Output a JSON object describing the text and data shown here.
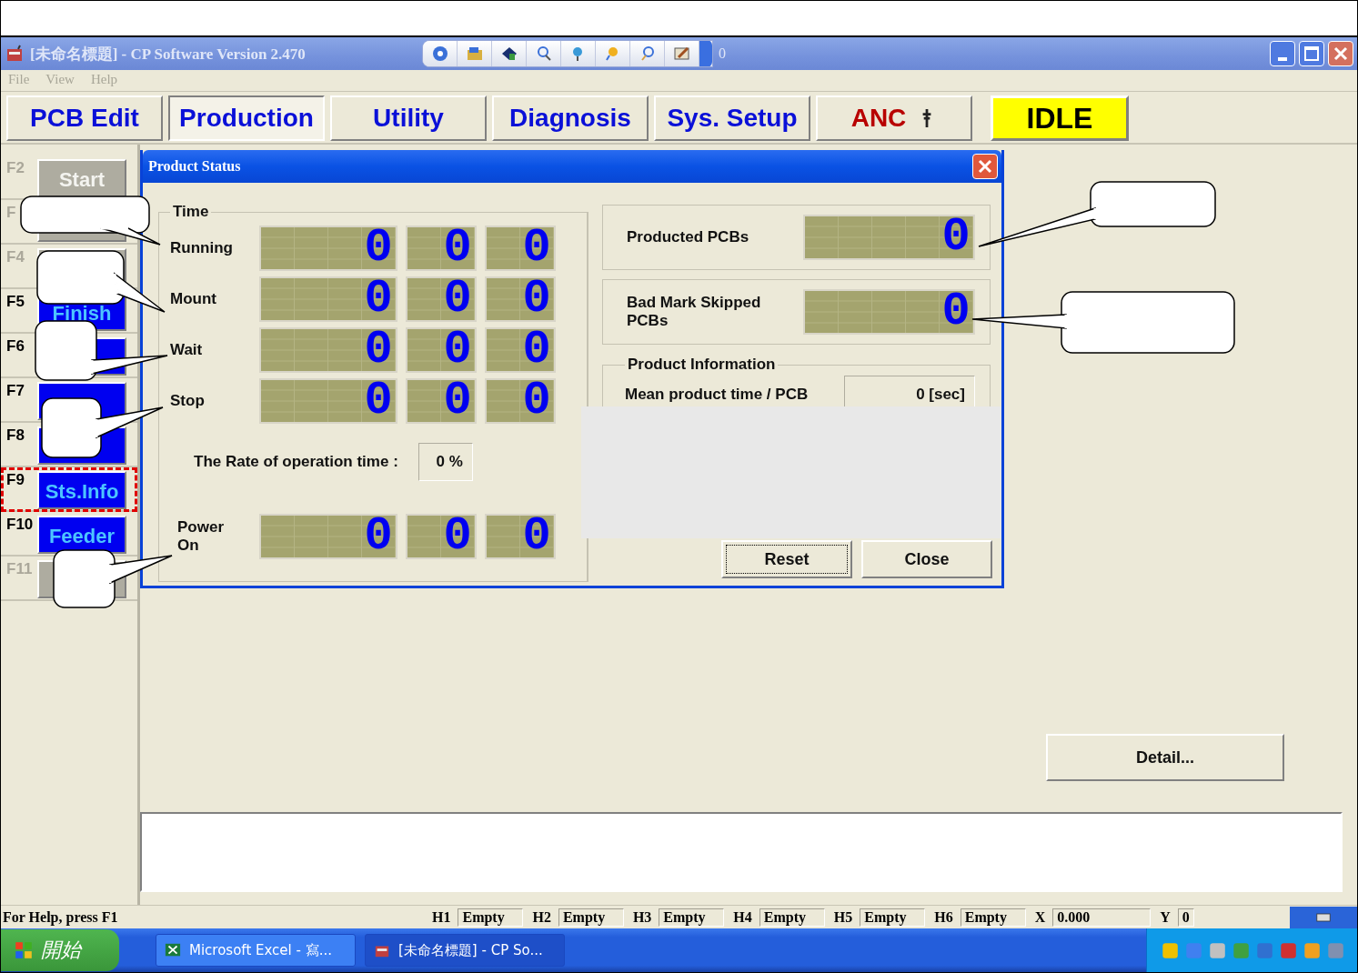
{
  "window": {
    "title": "[未命名標題] - CP Software Version 2.470",
    "toolbar_text": "0"
  },
  "menu": [
    {
      "label": "File",
      "disabled": true
    },
    {
      "label": "View",
      "disabled": true
    },
    {
      "label": "Help",
      "disabled": true
    }
  ],
  "tabs": [
    {
      "label": "PCB Edit",
      "kind": "mode",
      "selected": false
    },
    {
      "label": "Production",
      "kind": "mode",
      "selected": true
    },
    {
      "label": "Utility",
      "kind": "mode",
      "selected": false
    },
    {
      "label": "Diagnosis",
      "kind": "mode",
      "selected": false
    },
    {
      "label": "Sys. Setup",
      "kind": "mode",
      "selected": false
    },
    {
      "label": "ANC",
      "kind": "anc",
      "selected": false
    }
  ],
  "status_indicator": {
    "label": "IDLE"
  },
  "function_keys": [
    {
      "key": "F2",
      "label": "Start",
      "disabled": true,
      "selected": false
    },
    {
      "key": "F",
      "disabled": true,
      "selected": false
    },
    {
      "key": "F4",
      "disabled": true,
      "selected": false
    },
    {
      "key": "F5",
      "label": "Finish",
      "disabled": false,
      "selected": false
    },
    {
      "key": "F6",
      "disabled": false,
      "selected": false
    },
    {
      "key": "F7",
      "disabled": false,
      "selected": false
    },
    {
      "key": "F8",
      "disabled": false,
      "selected": false
    },
    {
      "key": "F9",
      "label": "Sts.Info",
      "disabled": false,
      "selected": true
    },
    {
      "key": "F10",
      "label": "Feeder",
      "disabled": false,
      "selected": false
    },
    {
      "key": "F11",
      "disabled": true,
      "selected": false
    }
  ],
  "dialog": {
    "title": "Product Status",
    "time": {
      "legend": "Time",
      "rows": [
        {
          "label": "Running",
          "values": [
            "0",
            "0",
            "0"
          ]
        },
        {
          "label": "Mount",
          "values": [
            "0",
            "0",
            "0"
          ]
        },
        {
          "label": "Wait",
          "values": [
            "0",
            "0",
            "0"
          ]
        },
        {
          "label": "Stop",
          "values": [
            "0",
            "0",
            "0"
          ]
        }
      ]
    },
    "rate": {
      "label": "The Rate of operation time :",
      "value": "0 %"
    },
    "power_on": {
      "label": "Power On",
      "values": [
        "0",
        "0",
        "0"
      ]
    },
    "counters": [
      {
        "label": "Producted PCBs",
        "value": "0"
      },
      {
        "label": "Bad Mark Skipped PCBs",
        "value": "0"
      }
    ],
    "product_info": {
      "legend": "Product Information",
      "label": "Mean product time / PCB",
      "value": "0 [sec]"
    },
    "buttons": [
      {
        "label": "Reset",
        "focused": true
      },
      {
        "label": "Close",
        "focused": false
      }
    ]
  },
  "detail_button": {
    "label": "Detail..."
  },
  "status_bar": {
    "help": "For Help, press F1",
    "fields": [
      {
        "label": "H1",
        "value": "Empty"
      },
      {
        "label": "H2",
        "value": "Empty"
      },
      {
        "label": "H3",
        "value": "Empty"
      },
      {
        "label": "H4",
        "value": "Empty"
      },
      {
        "label": "H5",
        "value": "Empty"
      },
      {
        "label": "H6",
        "value": "Empty"
      },
      {
        "label": "X",
        "value": "0.000"
      },
      {
        "label": "Y",
        "value": "0"
      }
    ]
  },
  "taskbar": {
    "start": "開始",
    "tasks": [
      {
        "label": "Microsoft Excel - 寫...",
        "kind": "excel"
      },
      {
        "label": "[未命名標題] - CP So...",
        "kind": "app"
      }
    ]
  }
}
